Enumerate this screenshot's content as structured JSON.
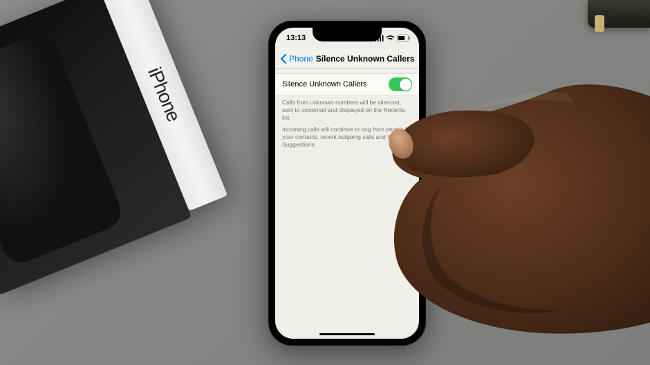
{
  "box": {
    "brand_text": "iPhone"
  },
  "status_bar": {
    "time": "13:13"
  },
  "nav": {
    "back_label": "Phone",
    "title": "Silence Unknown Callers"
  },
  "setting": {
    "label": "Silence Unknown Callers",
    "toggle_on": true
  },
  "description": {
    "p1": "Calls from unknown numbers will be silenced, sent to voicemail and displayed on the Recents list.",
    "p2": "Incoming calls will continue to ring from people in your contacts, recent outgoing calls and Siri Suggestions."
  },
  "colors": {
    "ios_blue": "#007aff",
    "toggle_green": "#34c759"
  }
}
